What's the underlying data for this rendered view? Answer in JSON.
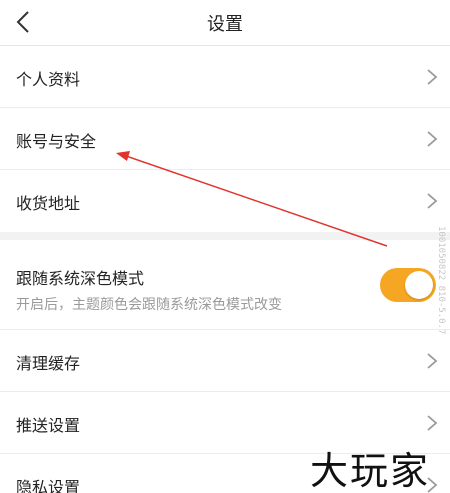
{
  "header": {
    "title": "设置",
    "back_icon": "chevron-left-icon"
  },
  "groups": {
    "account": {
      "items": [
        {
          "label": "个人资料"
        },
        {
          "label": "账号与安全"
        },
        {
          "label": "收货地址"
        }
      ]
    },
    "display": {
      "dark_mode_label": "跟随系统深色模式",
      "dark_mode_desc": "开启后，主题颜色会跟随系统深色模式改变",
      "dark_mode_enabled": true
    },
    "misc": {
      "items": [
        {
          "label": "清理缓存"
        },
        {
          "label": "推送设置"
        },
        {
          "label": "隐私设置"
        }
      ]
    }
  },
  "side_text": "1001050822 810-5.0.7",
  "watermark": "大玩家",
  "colors": {
    "accent": "#f5a623",
    "annotation_arrow": "#e0342c",
    "divider": "#ececec",
    "section_gap": "#f2f2f2"
  }
}
